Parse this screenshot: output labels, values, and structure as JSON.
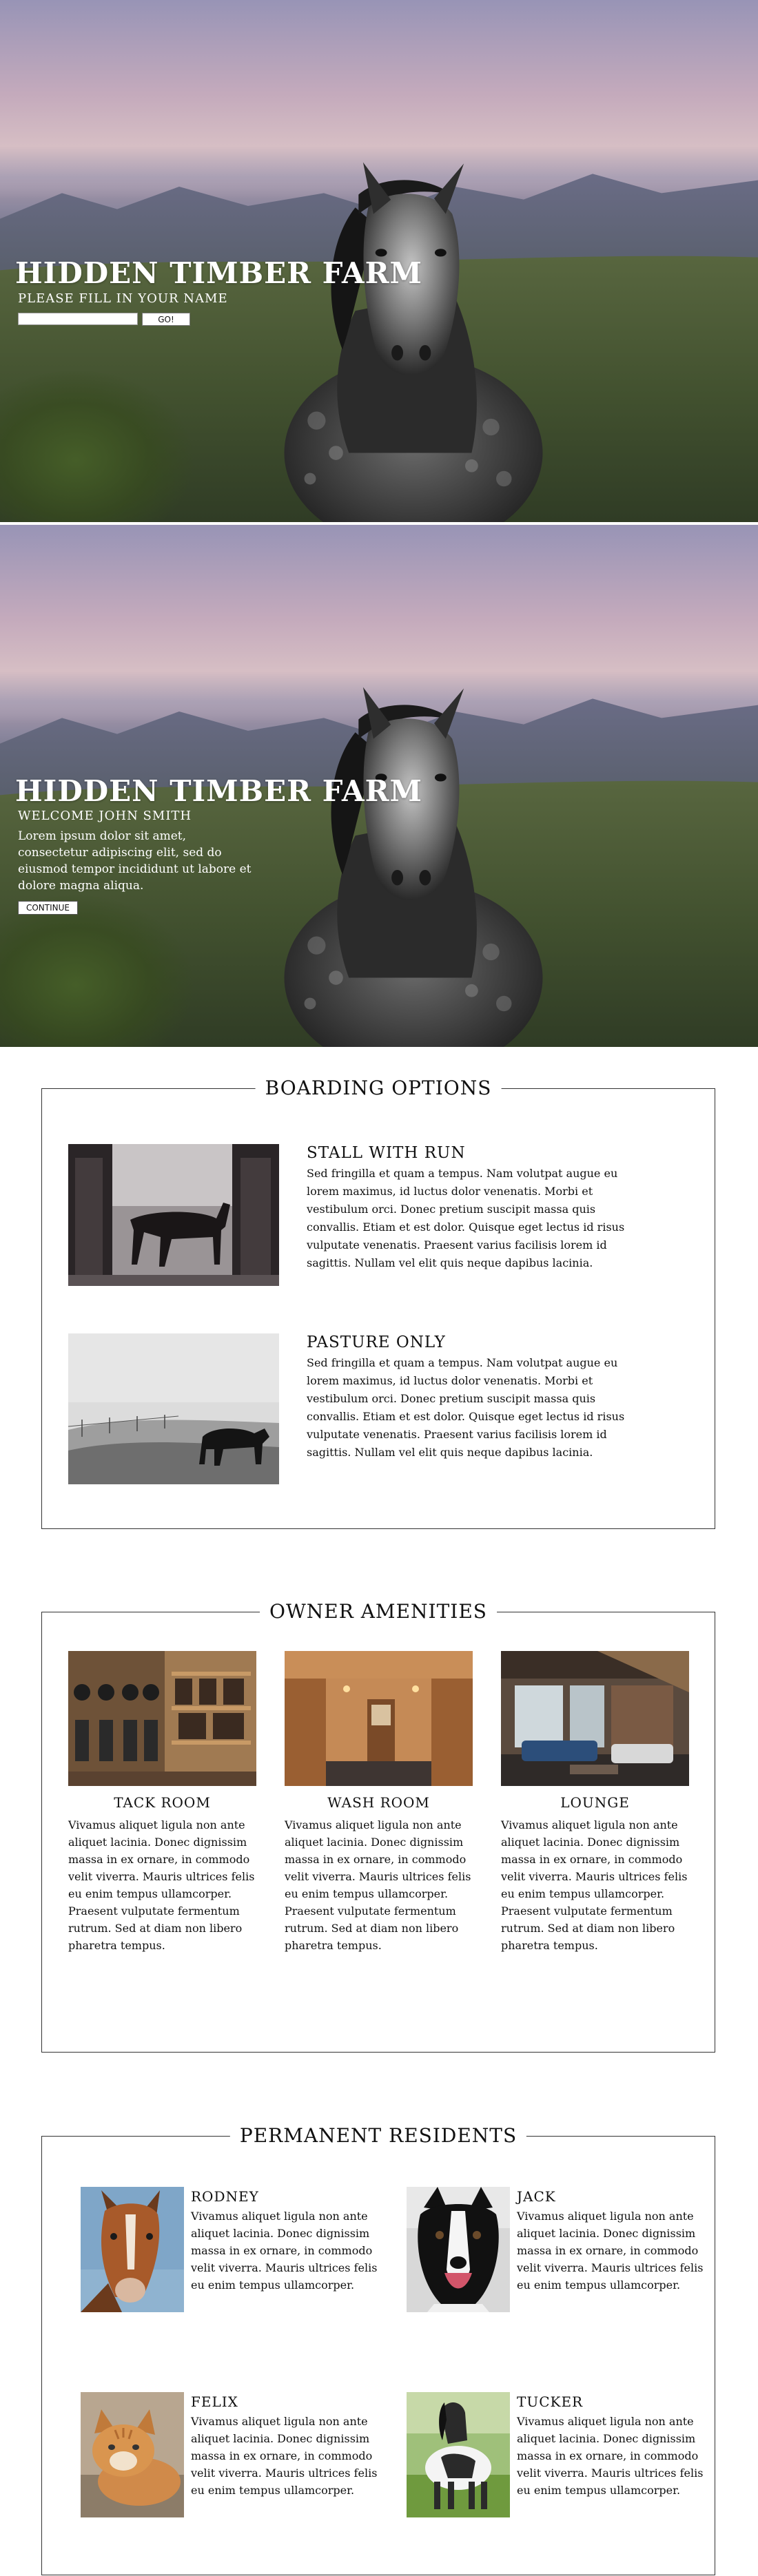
{
  "hero_login": {
    "title": "HIDDEN TIMBER FARM",
    "prompt": "PLEASE FILL IN YOUR NAME",
    "name_value": "",
    "go_label": "GO!"
  },
  "hero_welcome": {
    "title": "HIDDEN TIMBER FARM",
    "welcome": "WELCOME JOHN SMITH",
    "body": "Lorem ipsum dolor sit amet, consectetur adipiscing elit, sed do eiusmod tempor incididunt ut labore et dolore magna aliqua.",
    "continue_label": "CONTINUE"
  },
  "boarding": {
    "title": "BOARDING OPTIONS",
    "items": [
      {
        "heading": "STALL WITH RUN",
        "text": "Sed fringilla et quam a tempus. Nam volutpat augue eu lorem maximus, id luctus dolor venenatis. Morbi et vestibulum orci. Donec pretium suscipit massa quis convallis. Etiam et est dolor. Quisque eget lectus id risus vulputate venenatis. Praesent varius facilisis lorem id sagittis. Nullam vel elit quis neque dapibus lacinia."
      },
      {
        "heading": "PASTURE ONLY",
        "text": "Sed fringilla et quam a tempus. Nam volutpat augue eu lorem maximus, id luctus dolor venenatis. Morbi et vestibulum orci. Donec pretium suscipit massa quis convallis. Etiam et est dolor. Quisque eget lectus id risus vulputate venenatis. Praesent varius facilisis lorem id sagittis. Nullam vel elit quis neque dapibus lacinia."
      }
    ]
  },
  "amenities": {
    "title": "OWNER AMENITIES",
    "items": [
      {
        "heading": "TACK ROOM",
        "text": "Vivamus aliquet ligula non ante aliquet lacinia. Donec dignissim massa in ex ornare, in commodo velit viverra. Mauris ultrices felis eu enim tempus ullamcorper. Praesent vulputate fermentum rutrum. Sed at diam non libero pharetra tempus."
      },
      {
        "heading": "WASH ROOM",
        "text": "Vivamus aliquet ligula non ante aliquet lacinia. Donec dignissim massa in ex ornare, in commodo velit viverra. Mauris ultrices felis eu enim tempus ullamcorper. Praesent vulputate fermentum rutrum. Sed at diam non libero pharetra tempus."
      },
      {
        "heading": "LOUNGE",
        "text": "Vivamus aliquet ligula non ante aliquet lacinia. Donec dignissim massa in ex ornare, in commodo velit viverra. Mauris ultrices felis eu enim tempus ullamcorper. Praesent vulputate fermentum rutrum. Sed at diam non libero pharetra tempus."
      }
    ]
  },
  "residents": {
    "title": "PERMANENT RESIDENTS",
    "items": [
      {
        "name": "RODNEY",
        "text": "Vivamus aliquet ligula non ante aliquet lacinia. Donec dignissim massa in ex ornare, in commodo velit viverra. Mauris ultrices felis eu enim tempus ullamcorper."
      },
      {
        "name": "JACK",
        "text": "Vivamus aliquet ligula non ante aliquet lacinia. Donec dignissim massa in ex ornare, in commodo velit viverra. Mauris ultrices felis eu enim tempus ullamcorper."
      },
      {
        "name": "FELIX",
        "text": "Vivamus aliquet ligula non ante aliquet lacinia. Donec dignissim massa in ex ornare, in commodo velit viverra. Mauris ultrices felis eu enim tempus ullamcorper."
      },
      {
        "name": "TUCKER",
        "text": "Vivamus aliquet ligula non ante aliquet lacinia. Donec dignissim massa in ex ornare, in commodo velit viverra. Mauris ultrices felis eu enim tempus ullamcorper."
      }
    ]
  }
}
